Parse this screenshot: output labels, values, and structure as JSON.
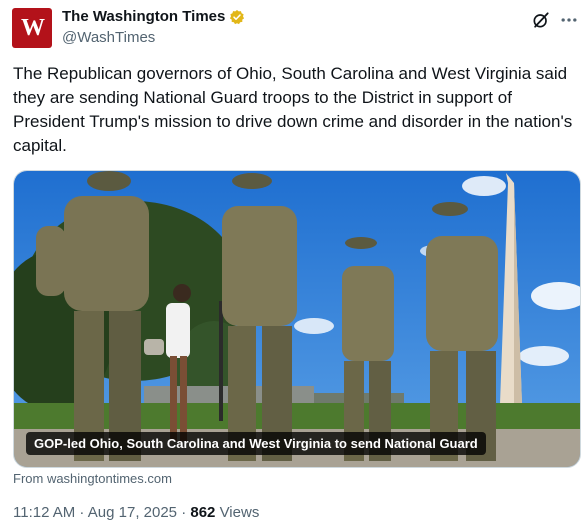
{
  "account": {
    "name": "The Washington Times",
    "handle": "@WashTimes",
    "avatar_letters": "W",
    "verified_color": "#e2b719"
  },
  "icons": {
    "grok": "grok-icon",
    "more": "more-icon",
    "verified": "verified-badge-icon"
  },
  "tweet": {
    "text": "The Republican governors of Ohio, South Carolina and West Virginia said they are sending National Guard troops to the District in support of President Trump's mission to drive down crime and disorder in the nation's capital."
  },
  "media": {
    "caption": "GOP-led Ohio, South Carolina and West Virginia to send National Guard",
    "source": "From washingtontimes.com"
  },
  "meta": {
    "time": "11:12 AM",
    "separator": " · ",
    "date": "Aug 17, 2025",
    "views_count": "862",
    "views_label": " Views"
  }
}
